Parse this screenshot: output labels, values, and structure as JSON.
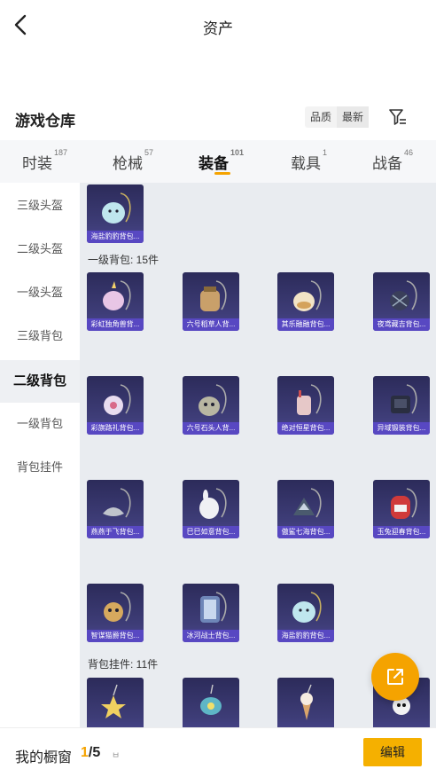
{
  "header": {
    "title": "资产"
  },
  "warehouse": {
    "title": "游戏仓库",
    "sort_options": [
      "品质",
      "最新"
    ]
  },
  "tabs": [
    {
      "label": "时装",
      "count": "187"
    },
    {
      "label": "枪械",
      "count": "57"
    },
    {
      "label": "装备",
      "count": "101"
    },
    {
      "label": "载具",
      "count": "1"
    },
    {
      "label": "战备",
      "count": "46"
    }
  ],
  "sidebar": {
    "items": [
      "三级头盔",
      "二级头盔",
      "一级头盔",
      "三级背包",
      "二级背包",
      "一级背包",
      "背包挂件"
    ],
    "active": "二级背包"
  },
  "items": {
    "top_row": [
      "海盐豹豹背包..."
    ],
    "section1_label": "一级背包: 15件",
    "row1": [
      "彩虹独角兽背...",
      "六号稻草人背...",
      "其乐融融背包...",
      "夜鸢藏吉背包..."
    ],
    "row2": [
      "彩旗路礼背包...",
      "六号石头人背...",
      "绝对恒星背包...",
      "异域锻装背包..."
    ],
    "row3": [
      "燕燕于飞背包...",
      "巳巳如意背包...",
      "傲鲨七海背包...",
      "玉兔迎春背包..."
    ],
    "row4": [
      "智谋猫爵背包...",
      "冰河战士背包...",
      "海盐豹豹背包..."
    ],
    "section2_label": "背包挂件: 11件"
  },
  "bottom": {
    "label": "我的橱窗",
    "current": "1",
    "total": "/5",
    "lock_icon": "ㅂ",
    "edit_label": "编辑"
  },
  "colors": {
    "accent": "#f5a300",
    "card_bg": "#2c2b5a",
    "card_caption": "#5848c2"
  }
}
